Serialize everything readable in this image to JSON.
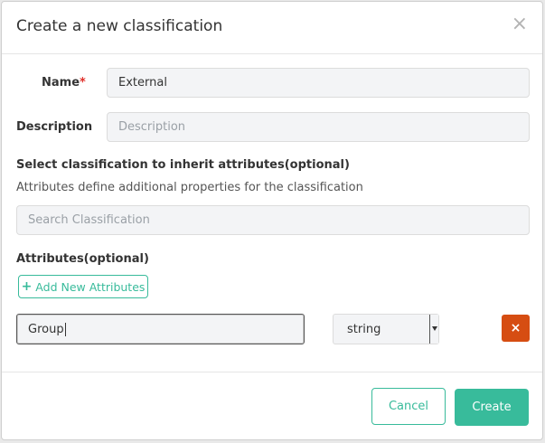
{
  "modal": {
    "title": "Create a new classification",
    "close_glyph": "×"
  },
  "form": {
    "name_label": "Name",
    "required_mark": "*",
    "name_value": "External",
    "description_label": "Description",
    "description_placeholder": "Description",
    "inherit_label": "Select classification to inherit attributes(optional)",
    "inherit_help": "Attributes define additional properties for the classification",
    "search_placeholder": "Search Classification",
    "attributes_label": "Attributes(optional)",
    "add_attributes_icon": "plus-icon",
    "add_attributes_plus": "+",
    "add_attributes_label": "Add New Attributes"
  },
  "attribute_row": {
    "name_value": "Group",
    "type_value": "string",
    "delete_glyph": "×"
  },
  "footer": {
    "cancel_label": "Cancel",
    "create_label": "Create"
  },
  "colors": {
    "accent": "#38bb9b",
    "danger": "#d64d12",
    "required": "#e0302a"
  }
}
